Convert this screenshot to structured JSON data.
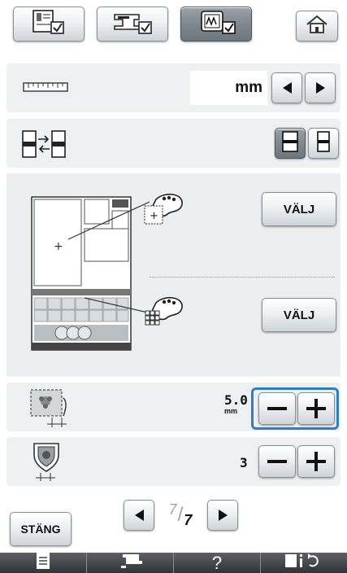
{
  "top_tabs": {
    "tab1_icon": "utility-settings-icon",
    "tab2_icon": "sewing-settings-icon",
    "tab3_icon": "embroidery-settings-icon",
    "active_tab": 3,
    "home_icon": "home-icon"
  },
  "units_row": {
    "icon": "ruler-icon",
    "value": "mm"
  },
  "display_row": {
    "icon": "display-swap-icon"
  },
  "choose_section": {
    "button1_label": "VÄLJ",
    "button2_label": "VÄLJ"
  },
  "row_a": {
    "icon": "embroidery-frame-distance-icon",
    "value_main": "5.0",
    "value_unit": "mm"
  },
  "row_b": {
    "icon": "shield-distance-icon",
    "value": "3"
  },
  "pager": {
    "current": "7",
    "total": "7"
  },
  "close_label": "STÄNG",
  "bottom_bar": {
    "help_label": "?"
  },
  "colors": {
    "highlight_blue": "#2d7fc4",
    "panel_bg": "#eef0f1"
  }
}
